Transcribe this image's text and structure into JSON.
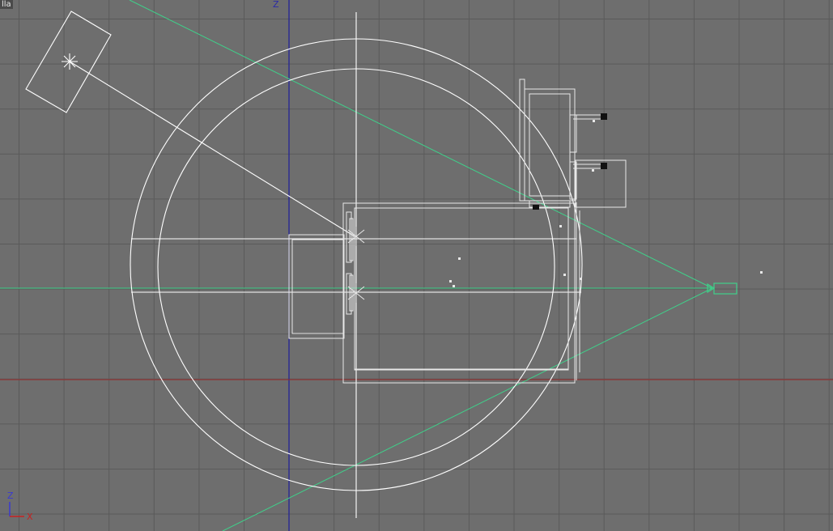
{
  "viewport": {
    "label": "lla",
    "top_axis_label": "Z",
    "tripod": {
      "up_label": "Z",
      "right_label": "X"
    }
  },
  "colors": {
    "background": "#6e6e6e",
    "grid": "#5a5a5a",
    "wire": "#ffffff",
    "wire_dim": "#d8d8d8",
    "camera": "#3fd08a",
    "z_axis": "#1f1f9a",
    "x_axis": "#c81e1e",
    "ground": "#9a2a2a"
  },
  "icons": {
    "light": "light-star-icon",
    "camera": "camera-icon",
    "tripod": "axis-tripod-icon"
  }
}
